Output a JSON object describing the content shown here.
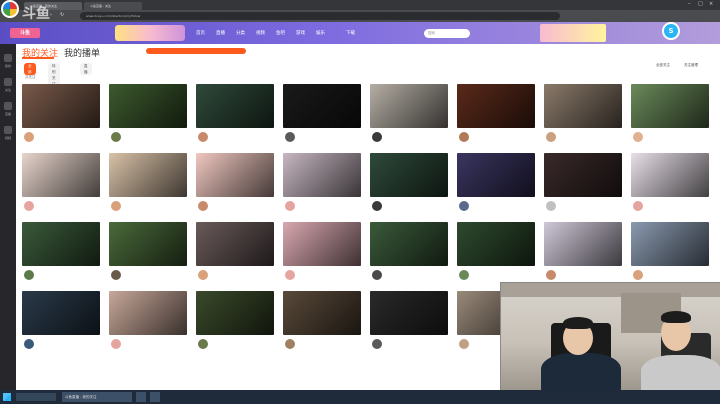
{
  "browser": {
    "tabs": [
      {
        "label": "斗鱼直播 - 我的关注"
      },
      {
        "label": "斗鱼直播 - 关注"
      }
    ],
    "url": "www.douyu.com/directory/myFollow"
  },
  "overlay_logo_text": "斗鱼",
  "site": {
    "logo_text": "斗鱼",
    "banner_text": "",
    "nav": [
      "首页",
      "直播",
      "分类",
      "视频",
      "鱼吧",
      "游戏",
      "娱乐",
      "下载"
    ],
    "search_placeholder": "搜索",
    "avatar_letter": "S"
  },
  "rail": {
    "items": [
      {
        "label": "我的",
        "icon": "user-icon"
      },
      {
        "label": "关注",
        "icon": "heart-icon"
      },
      {
        "label": "直播",
        "icon": "tv-icon"
      },
      {
        "label": "视频",
        "icon": "video-icon"
      }
    ]
  },
  "content": {
    "tabs": {
      "follow": "我的关注",
      "playlist": "我的播单"
    },
    "notice": "",
    "filters": [
      {
        "label": "全部",
        "active": true
      },
      {
        "label": "特别关注",
        "active": false
      },
      {
        "label": "直播",
        "active": false
      }
    ],
    "right_links": [
      "全部关注",
      "关注管理"
    ],
    "follow_note": "共关注"
  },
  "cards": [
    {
      "title": "",
      "name": "",
      "hot": "",
      "thumb": "#7a5a4a",
      "avatar": "#d9a07a"
    },
    {
      "title": "",
      "name": "",
      "hot": "",
      "thumb": "#3d5a2e",
      "avatar": "#6d7b4a"
    },
    {
      "title": "",
      "name": "",
      "hot": "",
      "thumb": "#2f4a3a",
      "avatar": "#c78b6b"
    },
    {
      "title": "",
      "name": "",
      "hot": "",
      "thumb": "#1a1a1a",
      "avatar": "#5a5a5a"
    },
    {
      "title": "",
      "name": "",
      "hot": "",
      "thumb": "#b5aea5",
      "avatar": "#3a3a3a"
    },
    {
      "title": "",
      "name": "",
      "hot": "",
      "thumb": "#5a2a1a",
      "avatar": "#b07a5a"
    },
    {
      "title": "",
      "name": "",
      "hot": "",
      "thumb": "#8a7a6a",
      "avatar": "#c9a080"
    },
    {
      "title": "",
      "name": "",
      "hot": "",
      "thumb": "#6a8a5a",
      "avatar": "#e0b090"
    },
    {
      "title": "",
      "name": "",
      "hot": "",
      "thumb": "#e8d5cc",
      "avatar": "#e6a4a0"
    },
    {
      "title": "",
      "name": "",
      "hot": "",
      "thumb": "#d9c2a8",
      "avatar": "#d9a07a"
    },
    {
      "title": "",
      "name": "",
      "hot": "",
      "thumb": "#f0c8c0",
      "avatar": "#c78b6b"
    },
    {
      "title": "",
      "name": "",
      "hot": "",
      "thumb": "#c7b7c2",
      "avatar": "#e6a4a0"
    },
    {
      "title": "",
      "name": "",
      "hot": "",
      "thumb": "#2e4a3a",
      "avatar": "#3a3a3a"
    },
    {
      "title": "",
      "name": "",
      "hot": "",
      "thumb": "#3a3560",
      "avatar": "#5a6a8a"
    },
    {
      "title": "",
      "name": "",
      "hot": "",
      "thumb": "#3a2a2a",
      "avatar": "#c0c0c0"
    },
    {
      "title": "",
      "name": "",
      "hot": "",
      "thumb": "#e8e0e8",
      "avatar": "#e6a4a0"
    },
    {
      "title": "",
      "name": "",
      "hot": "",
      "thumb": "#3a5a3a",
      "avatar": "#5a7a4a"
    },
    {
      "title": "",
      "name": "",
      "hot": "",
      "thumb": "#4a6a3a",
      "avatar": "#6a5a4a"
    },
    {
      "title": "",
      "name": "",
      "hot": "",
      "thumb": "#6a5a5a",
      "avatar": "#d9a07a"
    },
    {
      "title": "",
      "name": "",
      "hot": "",
      "thumb": "#d8a8b0",
      "avatar": "#e6a4a0"
    },
    {
      "title": "",
      "name": "",
      "hot": "",
      "thumb": "#3a5a3a",
      "avatar": "#4a4a4a"
    },
    {
      "title": "",
      "name": "",
      "hot": "",
      "thumb": "#2e4a2e",
      "avatar": "#6a8a5a"
    },
    {
      "title": "",
      "name": "",
      "hot": "",
      "thumb": "#d0c8d8",
      "avatar": "#c78b6b"
    },
    {
      "title": "",
      "name": "",
      "hot": "",
      "thumb": "#8a9ab0",
      "avatar": "#d9a07a"
    },
    {
      "title": "",
      "name": "",
      "hot": "",
      "thumb": "#2a3a4a",
      "avatar": "#3a5a7a"
    },
    {
      "title": "",
      "name": "",
      "hot": "",
      "thumb": "#c8a89a",
      "avatar": "#e6a4a0"
    },
    {
      "title": "",
      "name": "",
      "hot": "",
      "thumb": "#3a4a2a",
      "avatar": "#6a7a4a"
    },
    {
      "title": "",
      "name": "",
      "hot": "",
      "thumb": "#5a4a3a",
      "avatar": "#a08060"
    },
    {
      "title": "",
      "name": "",
      "hot": "",
      "thumb": "#2a2a2a",
      "avatar": "#5a5a5a"
    },
    {
      "title": "",
      "name": "",
      "hot": "",
      "thumb": "#9a8a7a",
      "avatar": "#c0a080"
    }
  ],
  "taskbar": {
    "apps": [
      "斗鱼直播 - 我的关注",
      "",
      ""
    ],
    "time": "",
    "date": ""
  }
}
